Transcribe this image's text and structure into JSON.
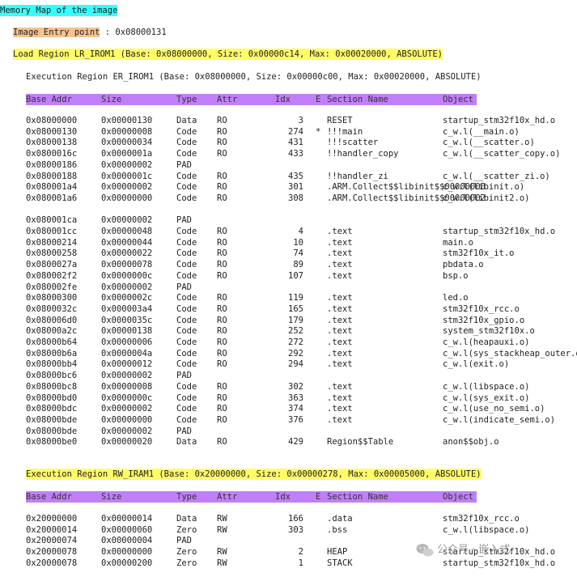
{
  "title": "Memory Map of the image",
  "entry_label": "Image Entry point",
  "entry_value": " : 0x08000131",
  "load_region": "Load Region LR_IROM1 (Base: 0x08000000, Size: 0x00000c14, Max: 0x00020000, ABSOLUTE)",
  "exec_region1": "Execution Region ER_IROM1 (Base: 0x08000000, Size: 0x00000c00, Max: 0x00020000, ABSOLUTE)",
  "exec_region2": "Execution Region RW_IRAM1 (Base: 0x20000000, Size: 0x00000278, Max: 0x00005000, ABSOLUTE)",
  "columns": {
    "base_addr": "Base Addr",
    "size": "Size",
    "type": "Type",
    "attr": "Attr",
    "idx": "Idx",
    "e": "E",
    "section": "Section Name",
    "object": "Object"
  },
  "table1": [
    {
      "addr": "0x08000000",
      "size": "0x00000130",
      "type": "Data",
      "attr": "RO",
      "idx": "3",
      "e": "",
      "section": "RESET",
      "object": "startup_stm32f10x_hd.o"
    },
    {
      "addr": "0x08000130",
      "size": "0x00000008",
      "type": "Code",
      "attr": "RO",
      "idx": "274",
      "e": "*",
      "section": "!!!main",
      "object": "c_w.l(__main.o)"
    },
    {
      "addr": "0x08000138",
      "size": "0x00000034",
      "type": "Code",
      "attr": "RO",
      "idx": "431",
      "e": "",
      "section": "!!!scatter",
      "object": "c_w.l(__scatter.o)"
    },
    {
      "addr": "0x0800016c",
      "size": "0x0000001a",
      "type": "Code",
      "attr": "RO",
      "idx": "433",
      "e": "",
      "section": "!!handler_copy",
      "object": "c_w.l(__scatter_copy.o)"
    },
    {
      "addr": "0x08000186",
      "size": "0x00000002",
      "type": "PAD",
      "attr": "",
      "idx": "",
      "e": "",
      "section": "",
      "object": ""
    },
    {
      "addr": "0x08000188",
      "size": "0x0000001c",
      "type": "Code",
      "attr": "RO",
      "idx": "435",
      "e": "",
      "section": "!!handler_zi",
      "object": "c_w.l(__scatter_zi.o)"
    },
    {
      "addr": "0x080001a4",
      "size": "0x00000002",
      "type": "Code",
      "attr": "RO",
      "idx": "301",
      "e": "",
      "section": ".ARM.Collect$$libinit$$00000000",
      "object": "c_w.l(libinit.o)"
    },
    {
      "addr": "0x080001a6",
      "size": "0x00000000",
      "type": "Code",
      "attr": "RO",
      "idx": "308",
      "e": "",
      "section": ".ARM.Collect$$libinit$$00000002",
      "object": "c_w.l(libinit2.o)"
    },
    {
      "blank": true
    },
    {
      "addr": "0x080001ca",
      "size": "0x00000002",
      "type": "PAD",
      "attr": "",
      "idx": "",
      "e": "",
      "section": "",
      "object": ""
    },
    {
      "addr": "0x080001cc",
      "size": "0x00000048",
      "type": "Code",
      "attr": "RO",
      "idx": "4",
      "e": "",
      "section": ".text",
      "object": "startup_stm32f10x_hd.o"
    },
    {
      "addr": "0x08000214",
      "size": "0x00000044",
      "type": "Code",
      "attr": "RO",
      "idx": "10",
      "e": "",
      "section": ".text",
      "object": "main.o"
    },
    {
      "addr": "0x08000258",
      "size": "0x00000022",
      "type": "Code",
      "attr": "RO",
      "idx": "74",
      "e": "",
      "section": ".text",
      "object": "stm32f10x_it.o"
    },
    {
      "addr": "0x0800027a",
      "size": "0x00000078",
      "type": "Code",
      "attr": "RO",
      "idx": "89",
      "e": "",
      "section": ".text",
      "object": "pbdata.o"
    },
    {
      "addr": "0x080002f2",
      "size": "0x0000000c",
      "type": "Code",
      "attr": "RO",
      "idx": "107",
      "e": "",
      "section": ".text",
      "object": "bsp.o"
    },
    {
      "addr": "0x080002fe",
      "size": "0x00000002",
      "type": "PAD",
      "attr": "",
      "idx": "",
      "e": "",
      "section": "",
      "object": ""
    },
    {
      "addr": "0x08000300",
      "size": "0x0000002c",
      "type": "Code",
      "attr": "RO",
      "idx": "119",
      "e": "",
      "section": ".text",
      "object": "led.o"
    },
    {
      "addr": "0x0800032c",
      "size": "0x000003a4",
      "type": "Code",
      "attr": "RO",
      "idx": "165",
      "e": "",
      "section": ".text",
      "object": "stm32f10x_rcc.o"
    },
    {
      "addr": "0x080006d0",
      "size": "0x0000035c",
      "type": "Code",
      "attr": "RO",
      "idx": "179",
      "e": "",
      "section": ".text",
      "object": "stm32f10x_gpio.o"
    },
    {
      "addr": "0x08000a2c",
      "size": "0x00000138",
      "type": "Code",
      "attr": "RO",
      "idx": "252",
      "e": "",
      "section": ".text",
      "object": "system_stm32f10x.o"
    },
    {
      "addr": "0x08000b64",
      "size": "0x00000006",
      "type": "Code",
      "attr": "RO",
      "idx": "272",
      "e": "",
      "section": ".text",
      "object": "c_w.l(heapauxi.o)"
    },
    {
      "addr": "0x08000b6a",
      "size": "0x0000004a",
      "type": "Code",
      "attr": "RO",
      "idx": "292",
      "e": "",
      "section": ".text",
      "object": "c_w.l(sys_stackheap_outer.o)"
    },
    {
      "addr": "0x08000bb4",
      "size": "0x00000012",
      "type": "Code",
      "attr": "RO",
      "idx": "294",
      "e": "",
      "section": ".text",
      "object": "c_w.l(exit.o)"
    },
    {
      "addr": "0x08000bc6",
      "size": "0x00000002",
      "type": "PAD",
      "attr": "",
      "idx": "",
      "e": "",
      "section": "",
      "object": ""
    },
    {
      "addr": "0x08000bc8",
      "size": "0x00000008",
      "type": "Code",
      "attr": "RO",
      "idx": "302",
      "e": "",
      "section": ".text",
      "object": "c_w.l(libspace.o)"
    },
    {
      "addr": "0x08000bd0",
      "size": "0x0000000c",
      "type": "Code",
      "attr": "RO",
      "idx": "363",
      "e": "",
      "section": ".text",
      "object": "c_w.l(sys_exit.o)"
    },
    {
      "addr": "0x08000bdc",
      "size": "0x00000002",
      "type": "Code",
      "attr": "RO",
      "idx": "374",
      "e": "",
      "section": ".text",
      "object": "c_w.l(use_no_semi.o)"
    },
    {
      "addr": "0x08000bde",
      "size": "0x00000000",
      "type": "Code",
      "attr": "RO",
      "idx": "376",
      "e": "",
      "section": ".text",
      "object": "c_w.l(indicate_semi.o)"
    },
    {
      "addr": "0x08000bde",
      "size": "0x00000002",
      "type": "PAD",
      "attr": "",
      "idx": "",
      "e": "",
      "section": "",
      "object": ""
    },
    {
      "addr": "0x08000be0",
      "size": "0x00000020",
      "type": "Data",
      "attr": "RO",
      "idx": "429",
      "e": "",
      "section": "Region$$Table",
      "object": "anon$$obj.o"
    }
  ],
  "table2": [
    {
      "addr": "0x20000000",
      "size": "0x00000014",
      "type": "Data",
      "attr": "RW",
      "idx": "166",
      "e": "",
      "section": ".data",
      "object": "stm32f10x_rcc.o"
    },
    {
      "addr": "0x20000014",
      "size": "0x00000060",
      "type": "Zero",
      "attr": "RW",
      "idx": "303",
      "e": "",
      "section": ".bss",
      "object": "c_w.l(libspace.o)"
    },
    {
      "addr": "0x20000074",
      "size": "0x00000004",
      "type": "PAD",
      "attr": "",
      "idx": "",
      "e": "",
      "section": "",
      "object": ""
    },
    {
      "addr": "0x20000078",
      "size": "0x00000000",
      "type": "Zero",
      "attr": "RW",
      "idx": "2",
      "e": "",
      "section": "HEAP",
      "object": "startup_stm32f10x_hd.o"
    },
    {
      "addr": "0x20000078",
      "size": "0x00000200",
      "type": "Zero",
      "attr": "RW",
      "idx": "1",
      "e": "",
      "section": "STACK",
      "object": "startup_stm32f10x_hd.o"
    }
  ],
  "watermark": "公众号 · 嵌入式",
  "watermark_icon": "wechat-icon"
}
